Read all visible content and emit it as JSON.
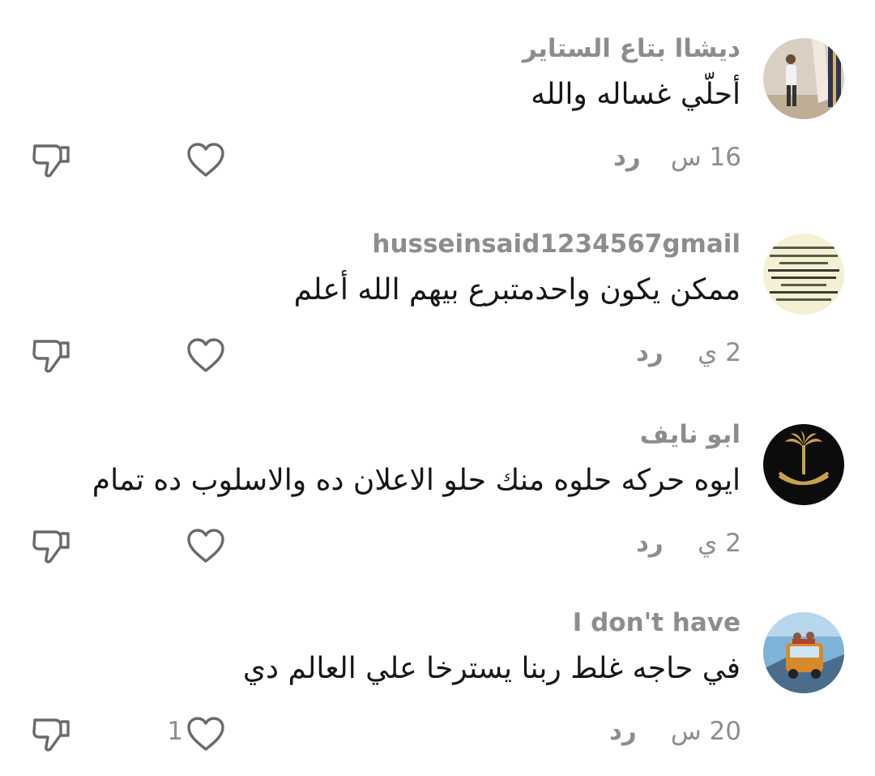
{
  "comments": [
    {
      "author": "ديشاا بتاع الستاير",
      "text": "أحلّي غساله والله",
      "time": "16 س",
      "reply_label": "رد",
      "like_count": ""
    },
    {
      "author": "husseinsaid1234567gmail",
      "text": "ممكن يكون واحدمتبرع بيهم الله أعلم",
      "time": "2 ي",
      "reply_label": "رد",
      "like_count": ""
    },
    {
      "author": "ابو نايف",
      "text": "ايوه حركه حلوه منك حلو الاعلان ده والاسلوب ده تمام",
      "time": "2 ي",
      "reply_label": "رد",
      "like_count": ""
    },
    {
      "author": "I don't have",
      "text": "في حاجه غلط ربنا يسترخا علي العالم دي",
      "time": "20 س",
      "reply_label": "رد",
      "like_count": "1"
    }
  ],
  "icons": {
    "like": "heart-outline-icon",
    "dislike": "thumbs-down-outline-icon"
  },
  "colors": {
    "text": "#161616",
    "secondary": "#8d8d8d",
    "icon": "#6a6a6a",
    "background": "#ffffff"
  }
}
